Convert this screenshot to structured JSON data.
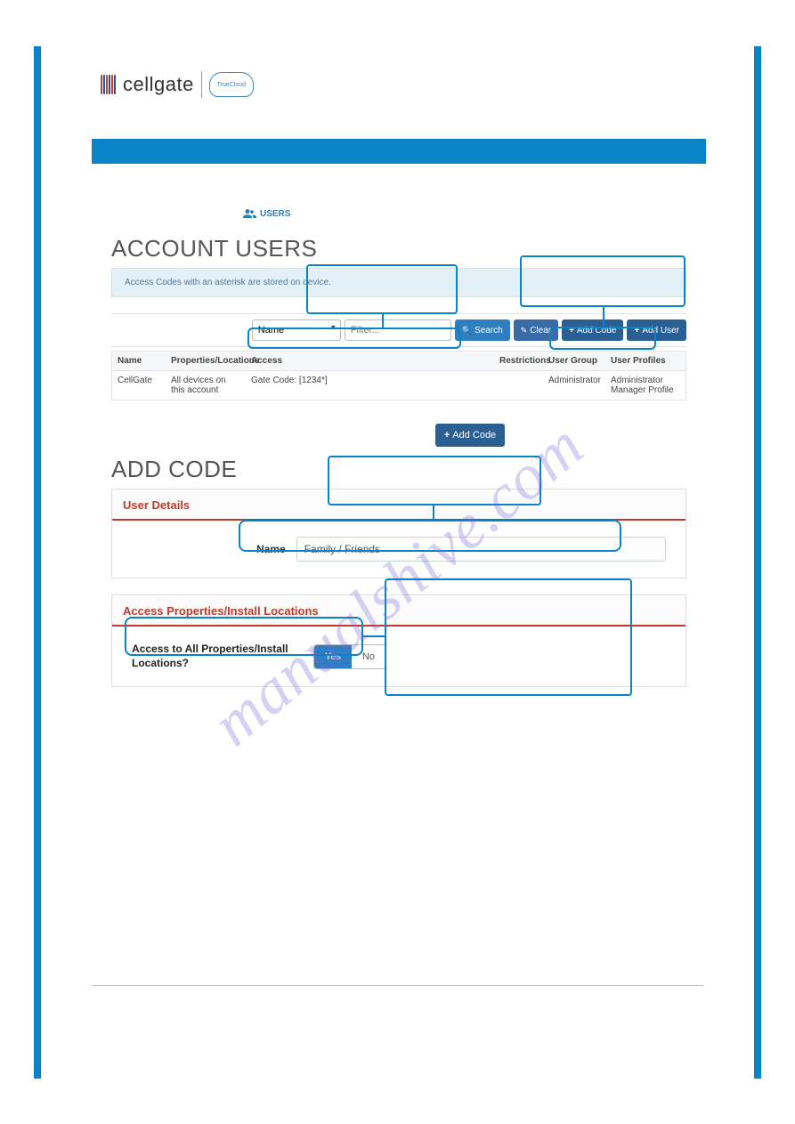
{
  "logo": {
    "brand": "cellgate",
    "cloud": "TrueCloud"
  },
  "users_tab": "USERS",
  "section1_title": "ACCOUNT USERS",
  "info_banner": "Access Codes with an asterisk are stored on device.",
  "filter": {
    "field": "Name",
    "placeholder": "Filter..."
  },
  "buttons": {
    "search": "Search",
    "clear": "Clear",
    "add_code": "Add Code",
    "add_user": "Add User"
  },
  "table": {
    "headers": [
      "Name",
      "Properties/Locations",
      "Access",
      "Restrictions",
      "User Group",
      "User Profiles"
    ],
    "rows": [
      {
        "name": "CellGate",
        "properties": "All devices on this account",
        "access": "Gate Code: [1234*]",
        "restrictions": "",
        "user_group": "Administrator",
        "user_profiles": "Administrator Manager Profile"
      }
    ]
  },
  "add_code_button": "Add Code",
  "section2_title": "ADD CODE",
  "panel_user_details": {
    "title": "User Details",
    "name_label": "Name",
    "name_value": "Family / Friends"
  },
  "panel_access": {
    "title": "Access Properties/Install Locations",
    "question": "Access to All Properties/Install Locations?",
    "yes": "Yes",
    "no": "No"
  },
  "watermark": "manualshive.com"
}
